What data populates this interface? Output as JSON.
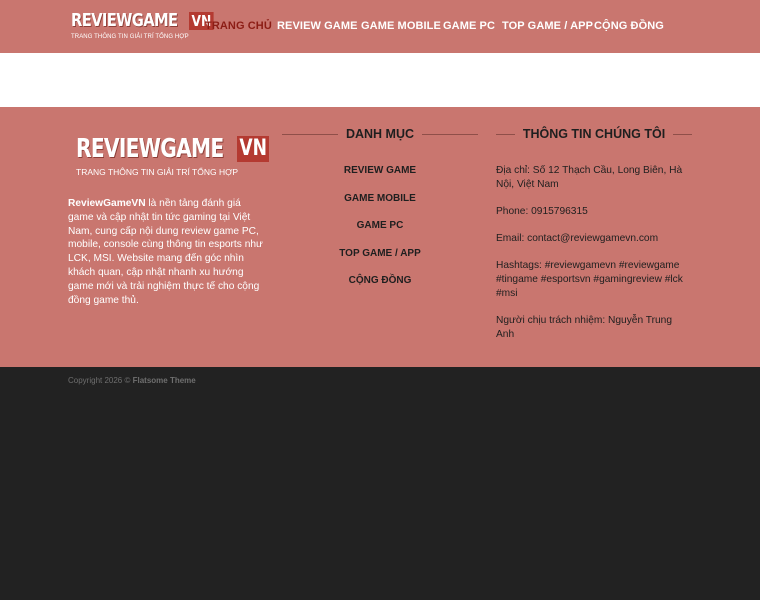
{
  "header": {
    "logo": {
      "brand": "REVIEWGAME",
      "suffix": "VN",
      "tagline": "TRANG THÔNG TIN GIẢI TRÍ TỔNG HỢP"
    },
    "nav": [
      {
        "label": "TRANG CHỦ",
        "active": true
      },
      {
        "label": "REVIEW GAME",
        "active": false
      },
      {
        "label": "GAME MOBILE",
        "active": false
      },
      {
        "label": "GAME PC",
        "active": false
      },
      {
        "label": "TOP GAME / APP",
        "active": false
      },
      {
        "label": "CỘNG ĐỒNG",
        "active": false
      }
    ]
  },
  "footer": {
    "logo": {
      "brand": "REVIEWGAME",
      "suffix": "VN",
      "tagline": "TRANG THÔNG TIN GIẢI TRÍ TỔNG HỢP"
    },
    "about": {
      "brand": "ReviewGameVN",
      "text": " là nền tảng đánh giá game và cập nhật tin tức gaming tại Việt Nam, cung cấp nội dung review game PC, mobile, console cùng thông tin esports như LCK, MSI. Website mang đến góc nhìn khách quan, cập nhật nhanh xu hướng game mới và trải nghiệm thực tế cho cộng đồng game thủ."
    },
    "menu": {
      "title": "DANH MỤC",
      "items": [
        "REVIEW GAME",
        "GAME MOBILE",
        "GAME PC",
        "TOP GAME / APP",
        "CỘNG ĐỒNG"
      ]
    },
    "info": {
      "title": "THÔNG TIN CHÚNG TÔI",
      "address": "Địa chỉ: Số 12 Thạch Cầu, Long Biên, Hà Nội, Việt Nam",
      "phone": "Phone: 0915796315",
      "email": "Email: contact@reviewgamevn.com",
      "hashtags": "Hashtags: #reviewgamevn #reviewgame #tingame #esportsvn #gamingreview #lck #msi",
      "responsible": "Người chịu trách nhiệm: Nguyễn Trung Anh"
    }
  },
  "bottom": {
    "copyright_prefix": "Copyright 2026 © ",
    "theme": "Flatsome Theme"
  },
  "colors": {
    "header_bg": "#c9766f",
    "active_nav": "#8c1d15",
    "footer_bg": "#c9766f",
    "bottom_bg": "#222222",
    "logo_badge": "#b43a31"
  }
}
